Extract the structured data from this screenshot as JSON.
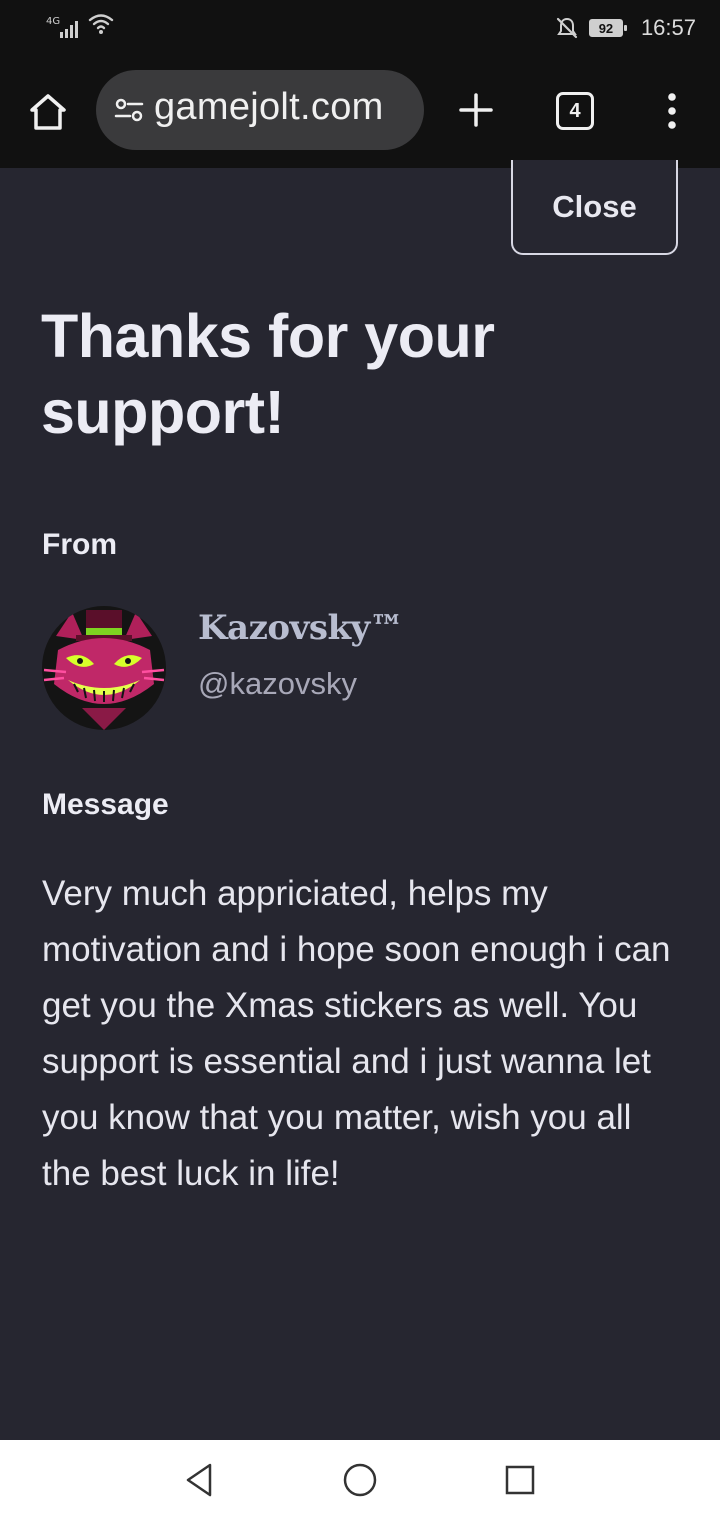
{
  "status_bar": {
    "network": "4G",
    "battery": "92",
    "time": "16:57",
    "icons": [
      "signal-icon",
      "wifi-icon",
      "mute-icon",
      "battery-icon"
    ]
  },
  "browser": {
    "url": "gamejolt.com",
    "tab_count": "4",
    "icons": [
      "home-icon",
      "site-settings-icon",
      "plus-icon",
      "tabs-icon",
      "more-vert-icon"
    ]
  },
  "modal": {
    "close_label": "Close",
    "title": "Thanks for your support!",
    "from_label": "From",
    "sender": {
      "display_name": "Kazovsky™",
      "username": "@kazovsky"
    },
    "message_label": "Message",
    "message": "Very much appriciated, helps my motivation and i hope soon enough i can get you the Xmas stickers as well. You support is essential and i just wanna let you know that you matter, wish you all the best luck in life!"
  },
  "nav": {
    "icons": [
      "back-icon",
      "home-circle-icon",
      "recents-icon"
    ]
  },
  "colors": {
    "background": "#262630",
    "chrome": "#111111",
    "text": "#ececf4",
    "muted": "#a8a8b8"
  }
}
